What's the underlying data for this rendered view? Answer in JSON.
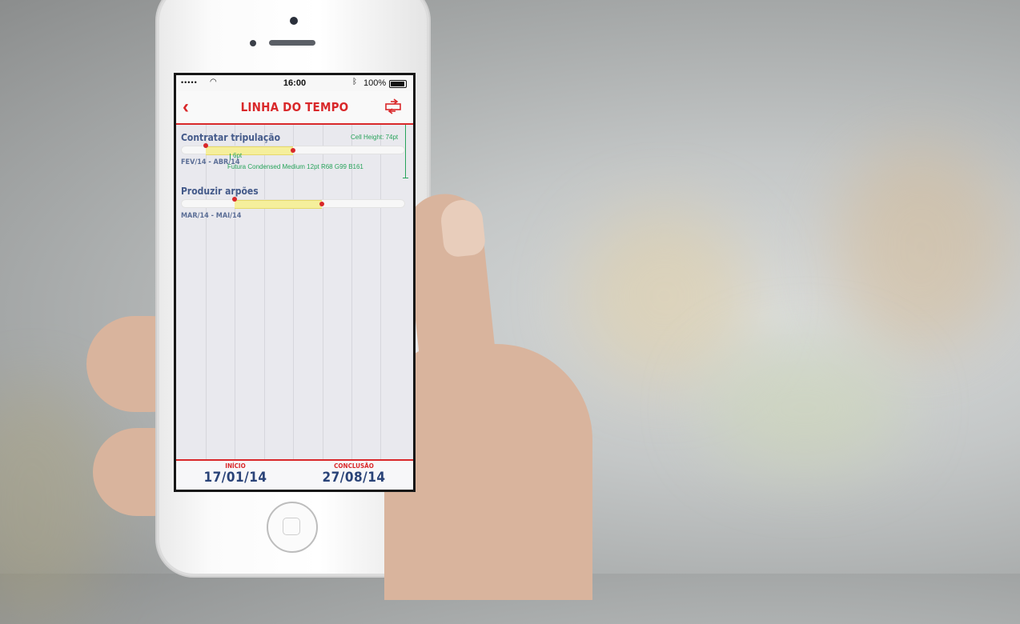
{
  "status_bar": {
    "signal": "•••••",
    "wifi": "◠",
    "time": "16:00",
    "bluetooth": "ᛒ",
    "battery": "100%"
  },
  "navbar": {
    "back_icon": "chevron-left-icon",
    "title": "LINHA DO TEMPO",
    "share_icon": "share-icon"
  },
  "tasks": [
    {
      "title": "Contratar tripulação",
      "dates": "FEV/14 - ABR/14"
    },
    {
      "title": "Produzir arpões",
      "dates": "MAR/14 - MAI/14"
    }
  ],
  "annotations": {
    "cell_height": "Cell Height: 74pt",
    "spacing": "6pt",
    "font_spec": "Futura Condensed Medium 12pt R68 G99 B161"
  },
  "footer": {
    "start_label": "INÍCIO",
    "start_date": "17/01/14",
    "end_label": "CONCLUSÃO",
    "end_date": "27/08/14"
  },
  "colors": {
    "accent": "#d9282a",
    "task_text": "#445a8a",
    "bar_fill": "#f5ef9c",
    "annotation": "#27a35a"
  }
}
